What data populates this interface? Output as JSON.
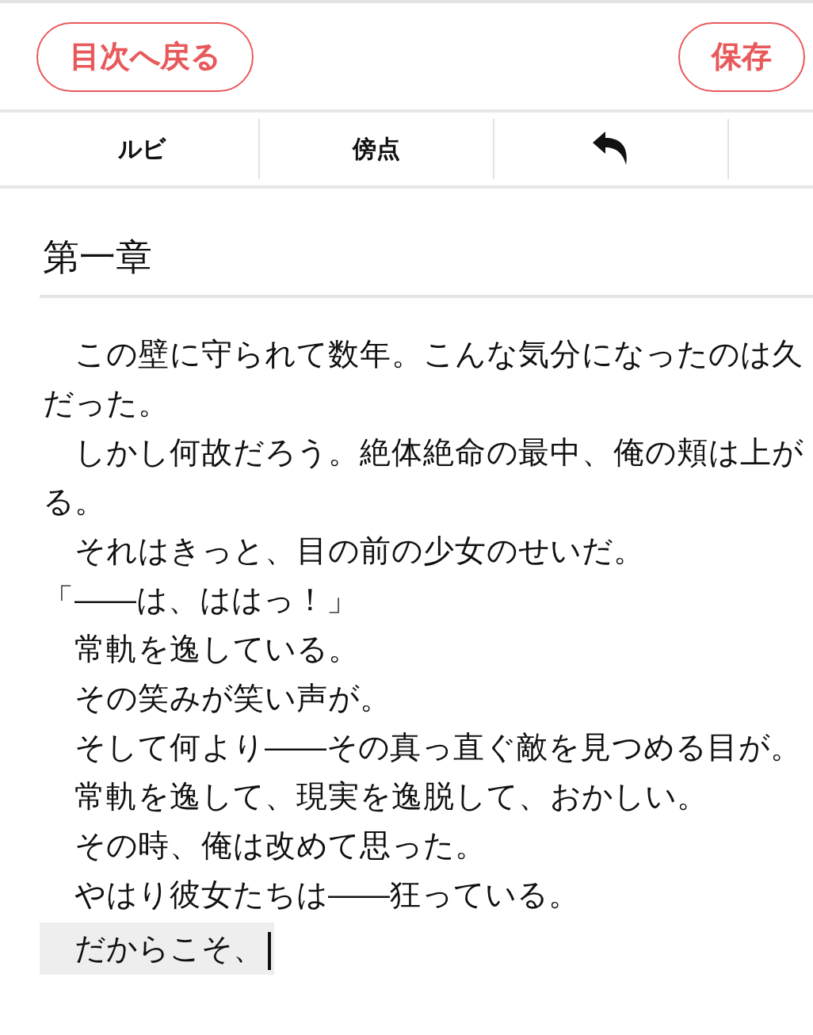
{
  "header": {
    "back_button": "目次へ戻る",
    "save_button": "保存"
  },
  "toolbar": [
    {
      "kind": "text",
      "label": "ルビ"
    },
    {
      "kind": "text",
      "label": "傍点"
    },
    {
      "kind": "undo"
    },
    {
      "kind": "empty"
    }
  ],
  "chapter_title": "第一章",
  "lines": [
    {
      "text": "　この壁に守られて数年。こんな気分になったのは久",
      "current": false
    },
    {
      "text": "だった。",
      "current": false
    },
    {
      "text": "　しかし何故だろう。絶体絶命の最中、俺の頬は上が",
      "current": false
    },
    {
      "text": "る。",
      "current": false
    },
    {
      "text": "　それはきっと、目の前の少女のせいだ。",
      "current": false
    },
    {
      "text": "「――は、ははっ！」",
      "current": false
    },
    {
      "text": "　常軌を逸している。",
      "current": false
    },
    {
      "text": "　その笑みが笑い声が。",
      "current": false
    },
    {
      "text": "　そして何より――その真っ直ぐ敵を見つめる目が。",
      "current": false
    },
    {
      "text": "　常軌を逸して、現実を逸脱して、おかしい。",
      "current": false
    },
    {
      "text": "　その時、俺は改めて思った。",
      "current": false
    },
    {
      "text": "　やはり彼女たちは――狂っている。",
      "current": false
    },
    {
      "text": "　だからこそ、",
      "current": true
    }
  ]
}
